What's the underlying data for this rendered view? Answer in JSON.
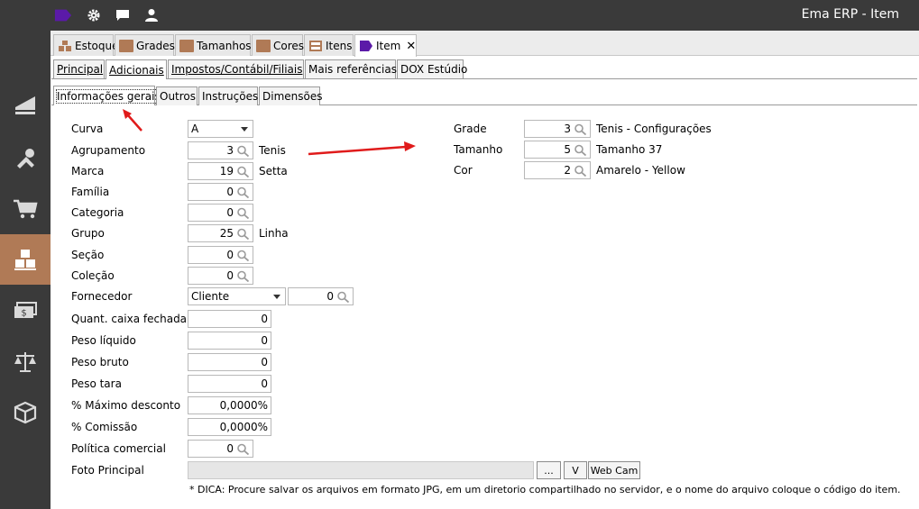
{
  "app": {
    "title": "Ema ERP - Item"
  },
  "topbar": {
    "icons": [
      "tag-icon",
      "gear-icon",
      "chat-icon",
      "user-icon"
    ]
  },
  "sidebar": {
    "items": [
      "chart-icon",
      "tools-icon",
      "cart-icon",
      "boxes-icon",
      "money-icon",
      "scale-icon",
      "package-icon"
    ],
    "active_index": 3
  },
  "window_tabs": [
    {
      "label": "Estoque",
      "icon": "boxes-icon"
    },
    {
      "label": "Grades",
      "icon": "folder-icon"
    },
    {
      "label": "Tamanhos",
      "icon": "folder-icon"
    },
    {
      "label": "Cores",
      "icon": "folder-icon"
    },
    {
      "label": "Itens",
      "icon": "cabinet-icon"
    },
    {
      "label": "Item",
      "icon": "tag-icon",
      "active": true,
      "close": "✕"
    }
  ],
  "section_tabs": [
    {
      "label": "Principal"
    },
    {
      "label": "Adicionais",
      "active": true
    },
    {
      "label": "Impostos/Contábil/Filiais"
    },
    {
      "label": "Mais referências"
    },
    {
      "label": "DOX Estúdio"
    }
  ],
  "inner_tabs": [
    {
      "label": "Informações gerais",
      "active": true
    },
    {
      "label": "Outros"
    },
    {
      "label": "Instruções"
    },
    {
      "label": "Dimensões"
    }
  ],
  "form": {
    "curva": {
      "label": "Curva",
      "value": "A"
    },
    "agrupamento": {
      "label": "Agrupamento",
      "value": "3",
      "desc": "Tenis"
    },
    "marca": {
      "label": "Marca",
      "value": "19",
      "desc": "Setta"
    },
    "familia": {
      "label": "Família",
      "value": "0"
    },
    "categoria": {
      "label": "Categoria",
      "value": "0"
    },
    "grupo": {
      "label": "Grupo",
      "value": "25",
      "desc": "Linha"
    },
    "secao": {
      "label": "Seção",
      "value": "0"
    },
    "colecao": {
      "label": "Coleção",
      "value": "0"
    },
    "fornecedor": {
      "label": "Fornecedor",
      "type": "Cliente",
      "value": "0"
    },
    "quant_caixa": {
      "label": "Quant. caixa fechada",
      "value": "0"
    },
    "peso_liquido": {
      "label": "Peso líquido",
      "value": "0"
    },
    "peso_bruto": {
      "label": "Peso bruto",
      "value": "0"
    },
    "peso_tara": {
      "label": "Peso tara",
      "value": "0"
    },
    "max_desconto": {
      "label": "% Máximo desconto",
      "value": "0,0000%"
    },
    "comissao": {
      "label": "% Comissão",
      "value": "0,0000%"
    },
    "politica": {
      "label": "Política comercial",
      "value": "0"
    },
    "foto": {
      "label": "Foto Principal",
      "value": "",
      "browse": "...",
      "view": "V",
      "webcam": "Web Cam"
    },
    "grade": {
      "label": "Grade",
      "value": "3",
      "desc": "Tenis - Configurações"
    },
    "tamanho": {
      "label": "Tamanho",
      "value": "5",
      "desc": "Tamanho 37"
    },
    "cor": {
      "label": "Cor",
      "value": "2",
      "desc": "Amarelo - Yellow"
    }
  },
  "hint": "* DICA: Procure salvar os arquivos em formato JPG, em um diretorio compartilhado no servidor, e o nome do arquivo coloque o código do item.",
  "colors": {
    "chrome": "#3a3a3a",
    "accent": "#b07a56",
    "tag": "#5b1aa8",
    "annotation": "#e01b1b"
  }
}
